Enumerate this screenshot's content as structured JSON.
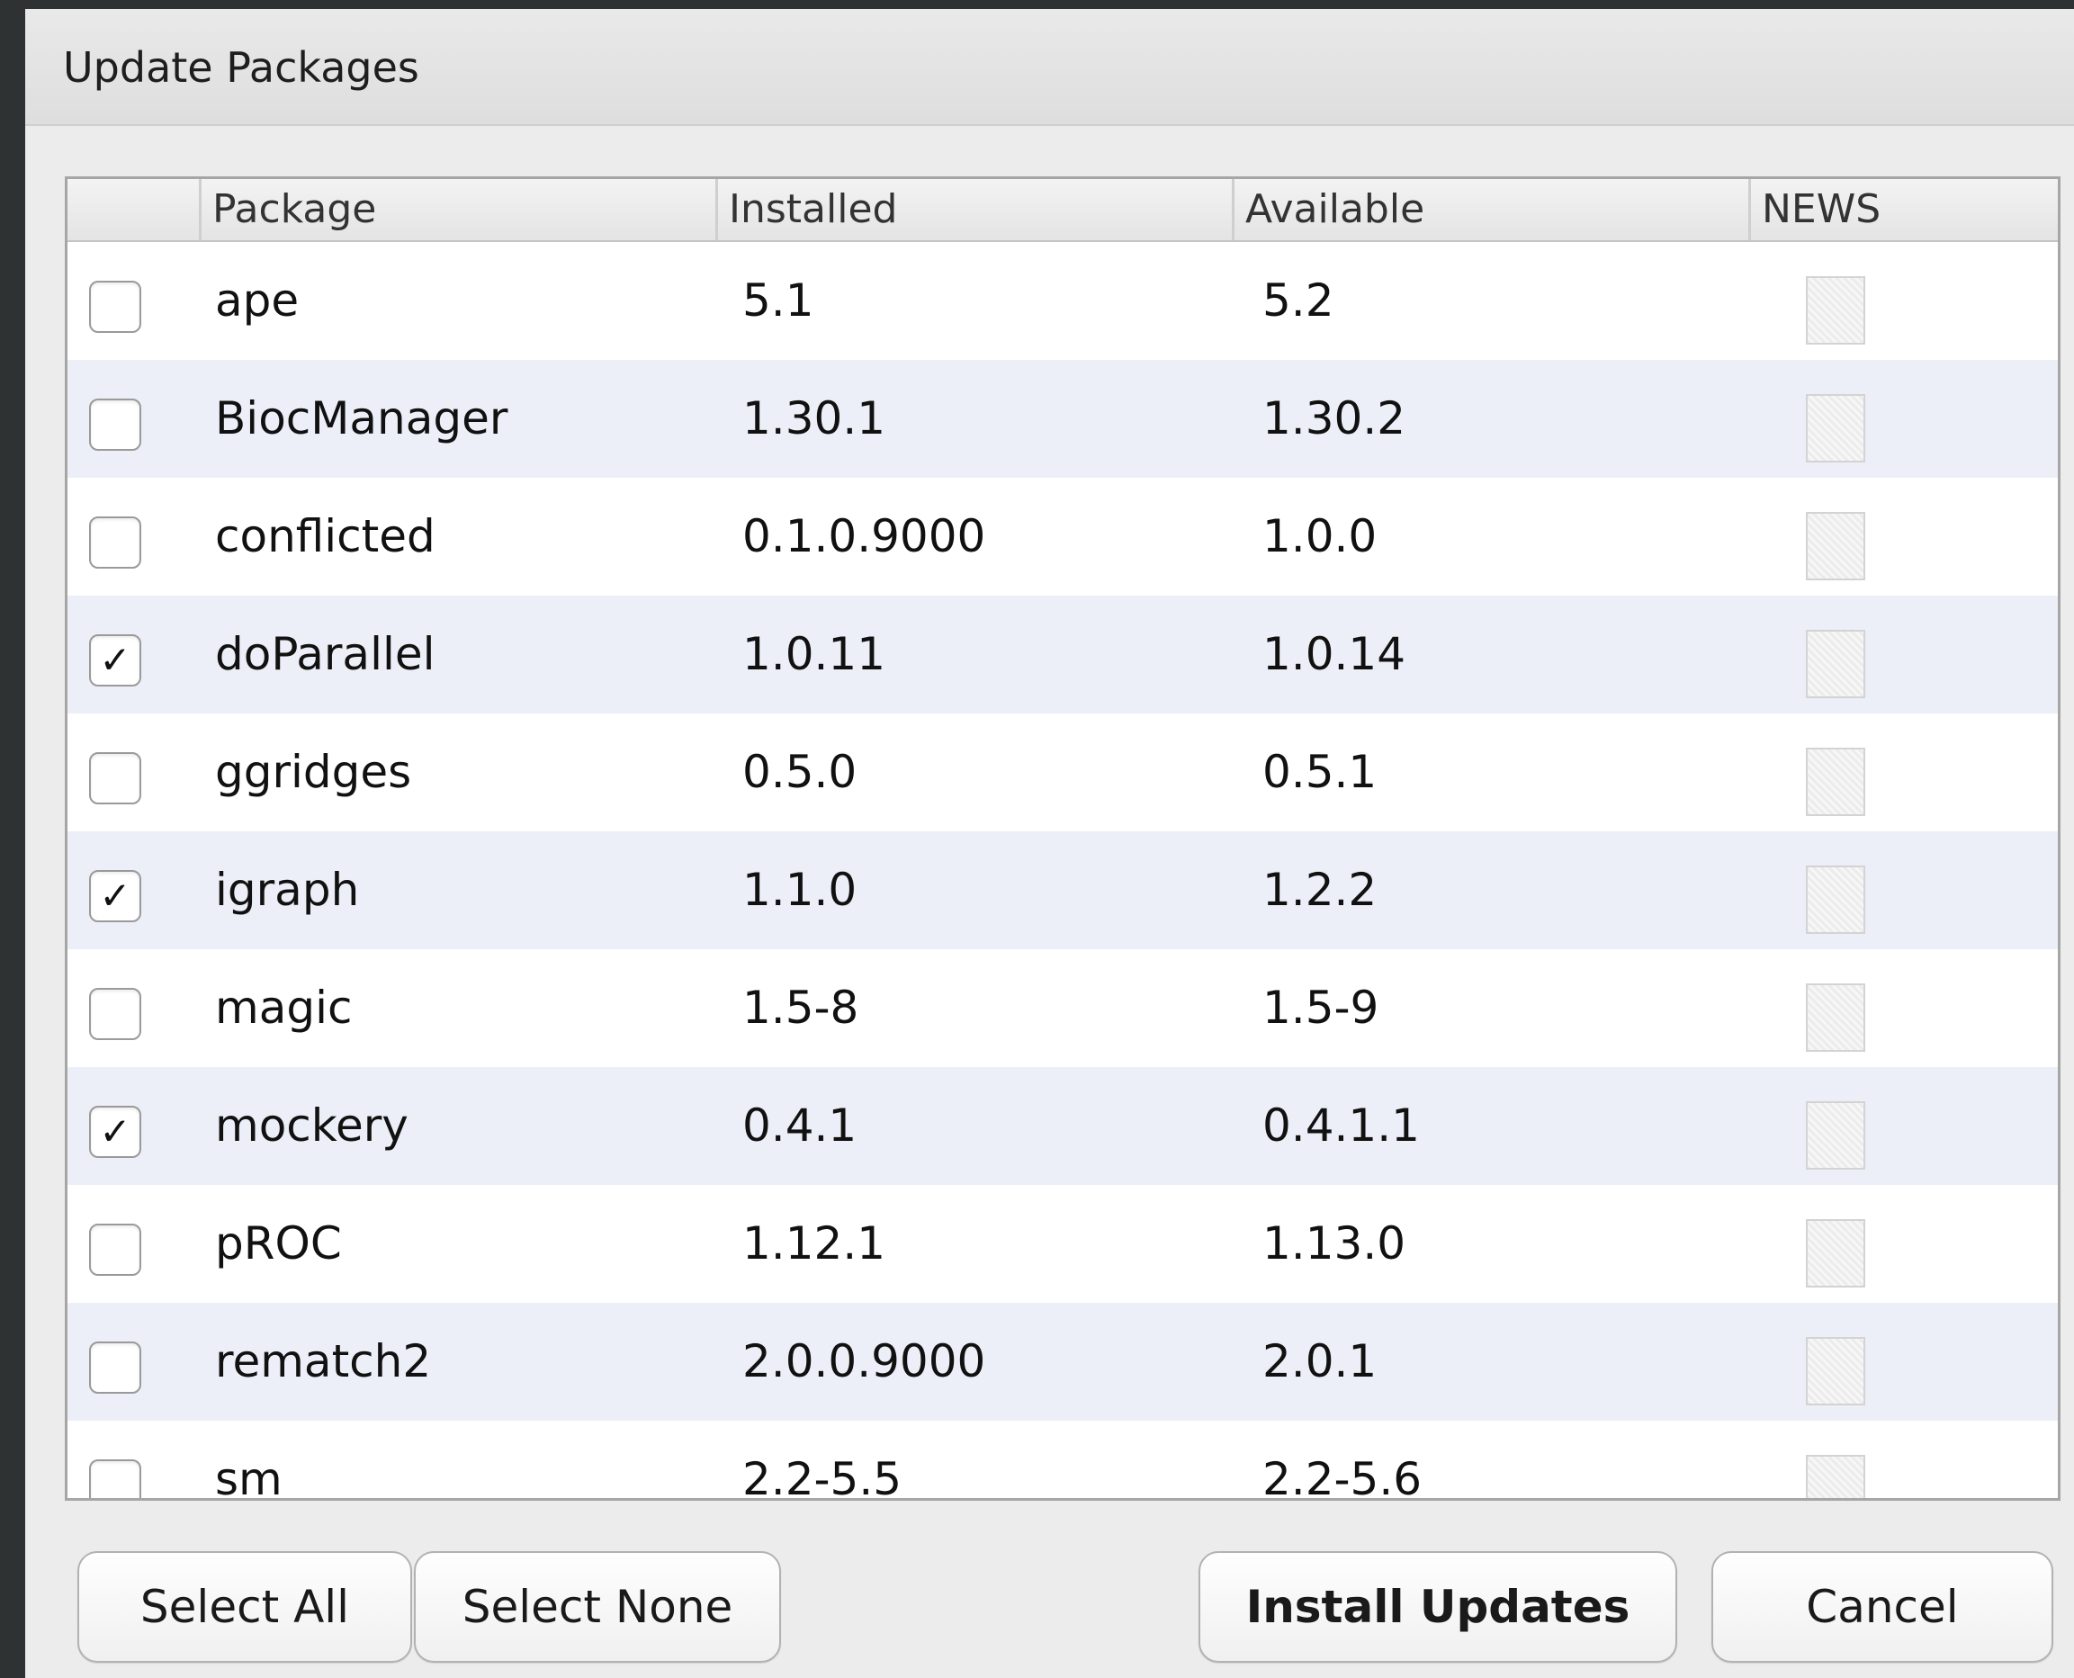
{
  "dialog": {
    "title": "Update Packages"
  },
  "table": {
    "columns": {
      "package": "Package",
      "installed": "Installed",
      "available": "Available",
      "news": "NEWS"
    },
    "rows": [
      {
        "checked": false,
        "package": "ape",
        "installed": "5.1",
        "available": "5.2"
      },
      {
        "checked": false,
        "package": "BiocManager",
        "installed": "1.30.1",
        "available": "1.30.2"
      },
      {
        "checked": false,
        "package": "conflicted",
        "installed": "0.1.0.9000",
        "available": "1.0.0"
      },
      {
        "checked": true,
        "package": "doParallel",
        "installed": "1.0.11",
        "available": "1.0.14"
      },
      {
        "checked": false,
        "package": "ggridges",
        "installed": "0.5.0",
        "available": "0.5.1"
      },
      {
        "checked": true,
        "package": "igraph",
        "installed": "1.1.0",
        "available": "1.2.2"
      },
      {
        "checked": false,
        "package": "magic",
        "installed": "1.5-8",
        "available": "1.5-9"
      },
      {
        "checked": true,
        "package": "mockery",
        "installed": "0.4.1",
        "available": "0.4.1.1"
      },
      {
        "checked": false,
        "package": "pROC",
        "installed": "1.12.1",
        "available": "1.13.0"
      },
      {
        "checked": false,
        "package": "rematch2",
        "installed": "2.0.0.9000",
        "available": "2.0.1"
      },
      {
        "checked": false,
        "package": "sm",
        "installed": "2.2-5.5",
        "available": "2.2-5.6"
      }
    ]
  },
  "buttons": {
    "select_all": "Select All",
    "select_none": "Select None",
    "install_updates": "Install Updates",
    "cancel": "Cancel"
  },
  "icons": {
    "checkmark": "✓",
    "news": "news-document-icon"
  }
}
